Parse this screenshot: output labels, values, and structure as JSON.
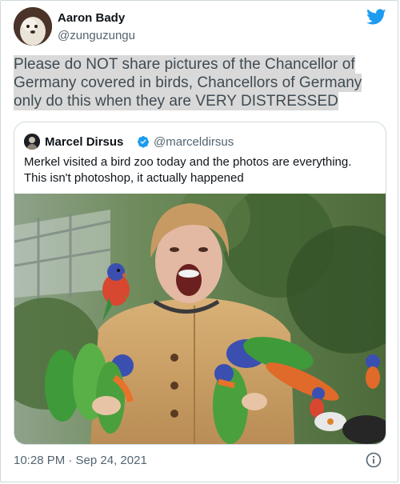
{
  "author": {
    "name": "Aaron Bady",
    "handle": "@zunguzungu"
  },
  "tweet": {
    "text": "Please do NOT share pictures of the Chancellor of Germany covered in birds,  Chancellors of Germany only do this when they are VERY DISTRESSED"
  },
  "quoted": {
    "name": "Marcel Dirsus",
    "handle": "@marceldirsus",
    "text_line1": "Merkel visited a bird zoo today and the photos are everything.",
    "text_line2": "This isn't photoshop, it actually happened"
  },
  "footer": {
    "timestamp": "10:28 PM · Sep 24, 2021"
  },
  "icons": {
    "brand": "twitter-bird-icon",
    "verified": "verified-badge-icon",
    "info": "info-icon"
  },
  "colors": {
    "brand_blue": "#1d9bf0",
    "text_primary": "#0f1419",
    "text_secondary": "#536471",
    "border": "#cfd9de",
    "highlight": "#d9d9d9"
  }
}
